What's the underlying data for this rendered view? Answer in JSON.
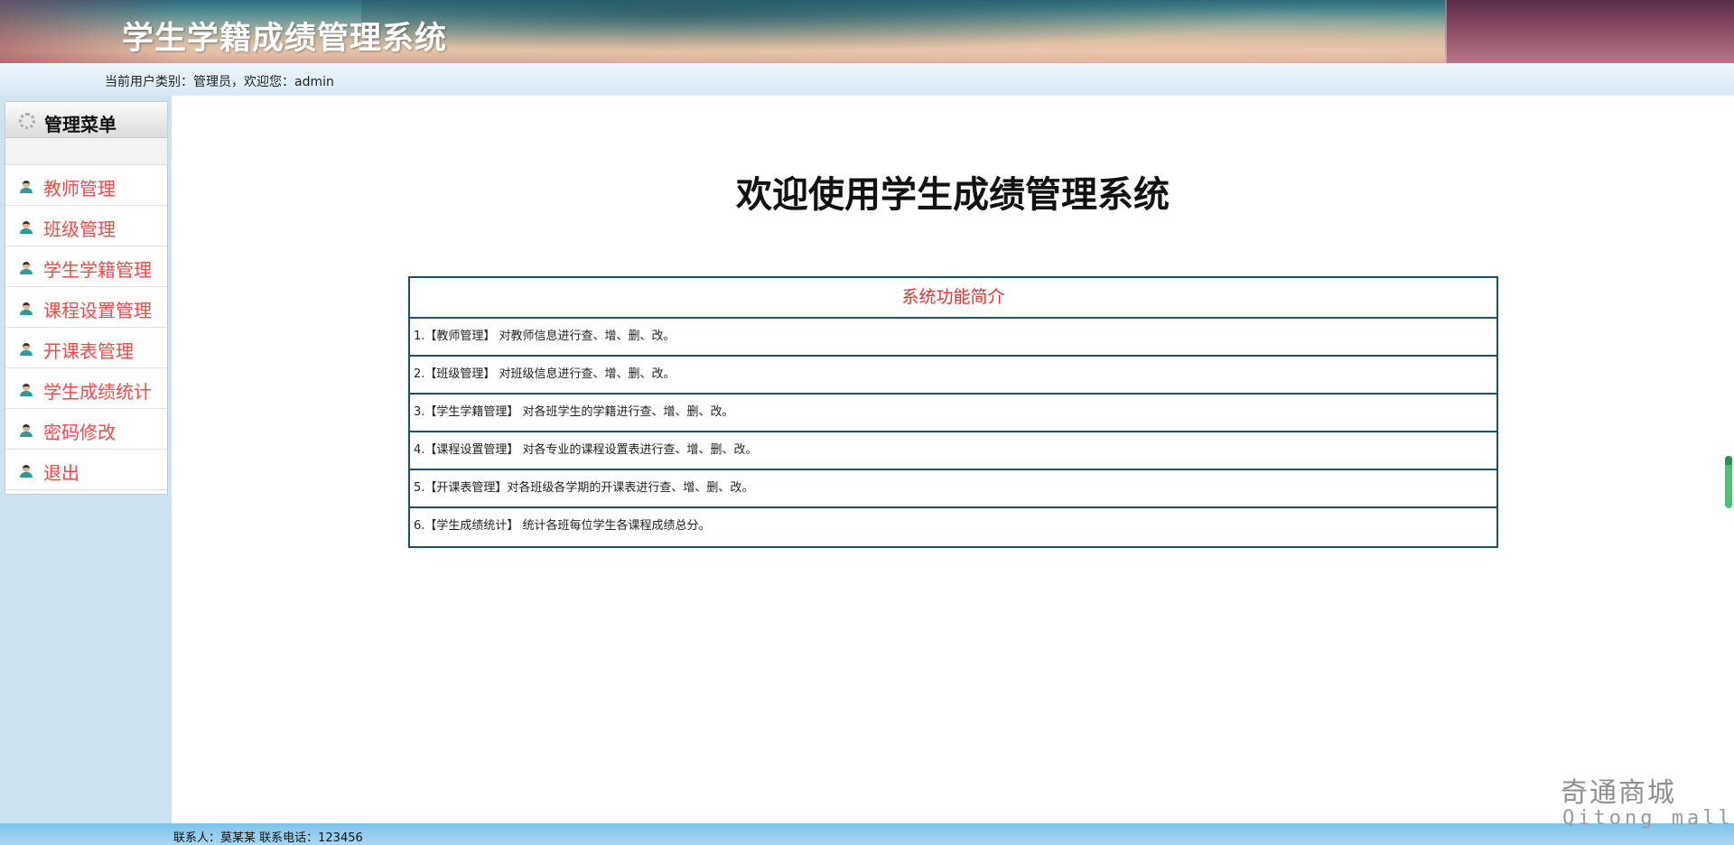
{
  "header": {
    "system_title": "学生学籍成绩管理系统"
  },
  "userbar": {
    "text": "当前用户类别：管理员，欢迎您：admin"
  },
  "sidebar": {
    "menu_title": "管理菜单",
    "items": [
      {
        "label": "教师管理"
      },
      {
        "label": "班级管理"
      },
      {
        "label": "学生学籍管理"
      },
      {
        "label": "课程设置管理"
      },
      {
        "label": "开课表管理"
      },
      {
        "label": "学生成绩统计"
      },
      {
        "label": "密码修改"
      },
      {
        "label": "退出"
      }
    ]
  },
  "main": {
    "welcome": "欢迎使用学生成绩管理系统",
    "intro": {
      "title": "系统功能简介",
      "rows": [
        "1.【教师管理】 对教师信息进行查、增、删、改。",
        "2.【班级管理】 对班级信息进行查、增、删、改。",
        "3.【学生学籍管理】 对各班学生的学籍进行查、增、删、改。",
        "4.【课程设置管理】 对各专业的课程设置表进行查、增、删、改。",
        "5.【开课表管理】对各班级各学期的开课表进行查、增、删、改。",
        "6.【学生成绩统计】 统计各班每位学生各课程成绩总分。"
      ]
    }
  },
  "footer": {
    "contact": "联系人：莫某某 联系电话：123456"
  },
  "watermark": {
    "line1": "奇通商城",
    "line2": "Qitong mall"
  },
  "colors": {
    "menu_text": "#f24a4a",
    "intro_title": "#e23232",
    "table_border": "#1e4f70",
    "sidebar_bg": "#cde3f2"
  }
}
